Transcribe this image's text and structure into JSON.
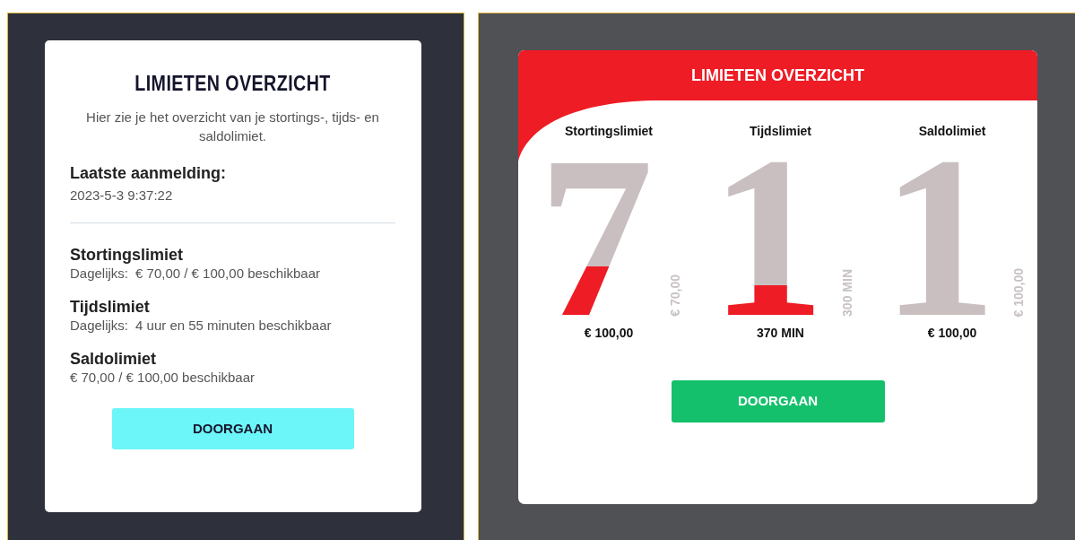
{
  "left_panel": {
    "title": "LIMIETEN OVERZICHT",
    "intro": "Hier zie je het overzicht van je stortings-, tijds- en saldolimiet.",
    "last_login": {
      "label": "Laatste aanmelding:",
      "value": "2023-5-3 9:37:22"
    },
    "limits": [
      {
        "name": "Stortingslimiet",
        "period": "Dagelijks:",
        "value": "€ 70,00 / € 100,00 beschikbaar"
      },
      {
        "name": "Tijdslimiet",
        "period": "Dagelijks:",
        "value": "4 uur en 55 minuten beschikbaar"
      },
      {
        "name": "Saldolimiet",
        "value": "€ 70,00 / € 100,00 beschikbaar"
      }
    ],
    "button": "DOORGAAN"
  },
  "right_panel": {
    "title": "LIMIETEN OVERZICHT",
    "limits": [
      {
        "name": "Stortingslimiet",
        "digit": "7",
        "level": 0.3,
        "side_label": "€ 70,00",
        "amount": "€ 100,00"
      },
      {
        "name": "Tijdslimiet",
        "digit": "1",
        "level": 0.19,
        "side_label": "300 MIN",
        "amount": "370 MIN"
      },
      {
        "name": "Saldolimiet",
        "digit": "1",
        "level": 0,
        "side_label": "€ 100,00",
        "amount": "€ 100,00"
      }
    ],
    "button": "DOORGAAN"
  }
}
